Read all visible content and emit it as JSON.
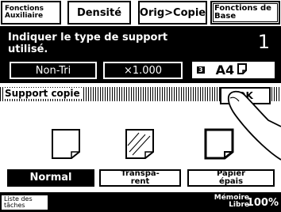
{
  "tabs": [
    {
      "label": "Fonctions Auxiliaire"
    },
    {
      "label": "Densité"
    },
    {
      "label": "Orig>Copie"
    },
    {
      "label": "Fonctions de Base"
    }
  ],
  "message": {
    "line1": "Indiquer le type de support",
    "line2": "utilisé.",
    "copies": "1"
  },
  "settings": {
    "sort": "Non-Tri",
    "zoom": "×1.000",
    "tray_number": "3",
    "paper_size": "A4"
  },
  "section": {
    "title": "Support copie",
    "ok_label": "OK"
  },
  "paper_types": [
    {
      "label": "Normal",
      "selected": true
    },
    {
      "label": "Transpa-\nrent",
      "selected": false
    },
    {
      "label": "Papier\népais",
      "selected": false
    }
  ],
  "footer": {
    "job_list": "Liste des\ntâches",
    "memory_label": "Mémoire\nLibre",
    "memory_value": "100%"
  },
  "colors": {
    "foreground": "#000000",
    "background": "#ffffff"
  }
}
